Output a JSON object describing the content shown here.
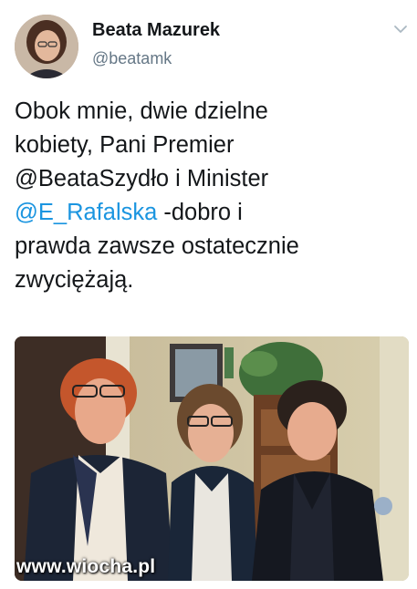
{
  "author": {
    "name": "Beata Mazurek",
    "handle": "@beatamk"
  },
  "tweet": {
    "line1": "Obok mnie, dwie dzielne",
    "line2": "kobiety, Pani Premier",
    "line3": "@BeataSzydło i Minister",
    "mention": "@E_Rafalska",
    "line4_rest": " -dobro i",
    "line5": "prawda zawsze ostatecznie",
    "line6": "zwyciężają."
  },
  "icons": {
    "menu": "chevron-down-icon"
  },
  "colors": {
    "link": "#1b95e0",
    "handle": "#657786",
    "text": "#14171a"
  },
  "watermark": "www.wiocha.pl"
}
